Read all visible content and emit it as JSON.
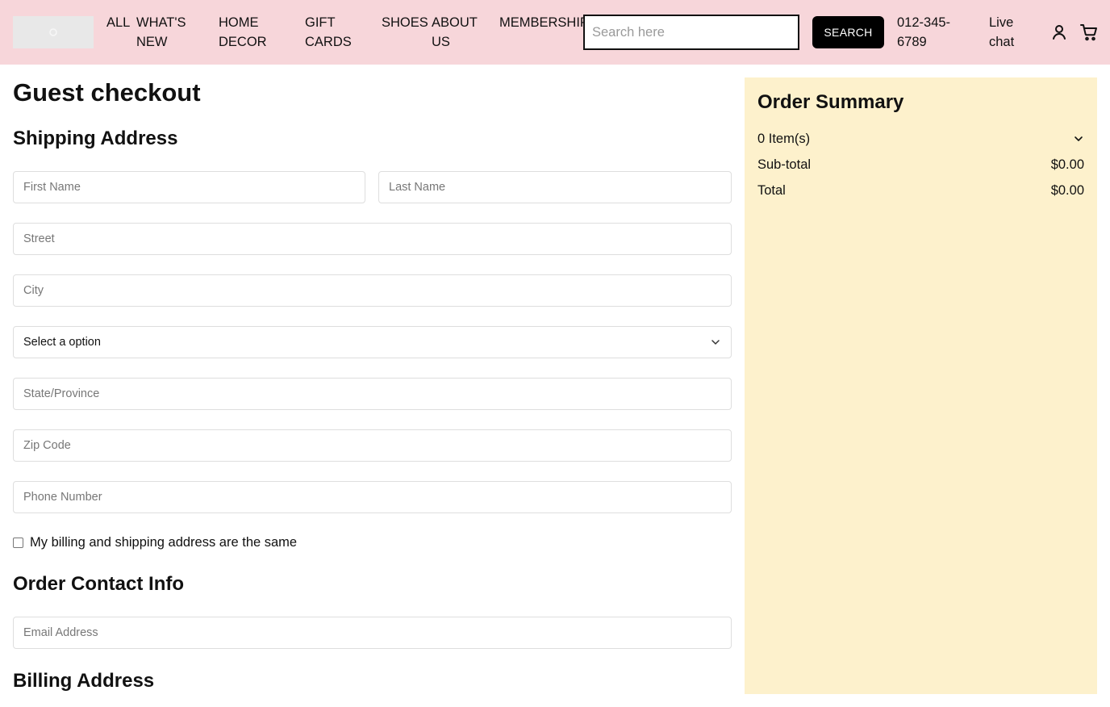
{
  "header": {
    "nav": [
      {
        "line1": "ALL",
        "line2": ""
      },
      {
        "line1": "WHAT'S",
        "line2": "NEW"
      },
      {
        "line1": "HOME",
        "line2": "DECOR"
      },
      {
        "line1": "GIFT",
        "line2": "CARDS"
      },
      {
        "line1": "SHOES",
        "line2": ""
      },
      {
        "line1": "ABOUT",
        "line2": "US"
      },
      {
        "line1": "MEMBERSHIP",
        "line2": ""
      }
    ],
    "search_placeholder": "Search here",
    "search_button": "SEARCH",
    "phone_line1": "012-345-",
    "phone_line2": "6789",
    "chat_line1": "Live",
    "chat_line2": "chat",
    "account_icon": "user-icon",
    "cart_icon": "cart-icon",
    "background_color": "#f7d6da"
  },
  "page_title": "Guest checkout",
  "shipping": {
    "title": "Shipping Address",
    "first_name_placeholder": "First Name",
    "last_name_placeholder": "Last Name",
    "street_placeholder": "Street",
    "city_placeholder": "City",
    "country_select_value": "Select a option",
    "state_placeholder": "State/Province",
    "zip_placeholder": "Zip Code",
    "phone_placeholder": "Phone Number",
    "same_address_label": "My billing and shipping address are the same"
  },
  "contact": {
    "title": "Order Contact Info",
    "email_placeholder": "Email Address"
  },
  "billing": {
    "title": "Billing Address"
  },
  "summary": {
    "title": "Order Summary",
    "items_label": "0 Item(s)",
    "subtotal_label": "Sub-total",
    "subtotal_value": "$0.00",
    "total_label": "Total",
    "total_value": "$0.00",
    "background_color": "#fdf1cc"
  }
}
